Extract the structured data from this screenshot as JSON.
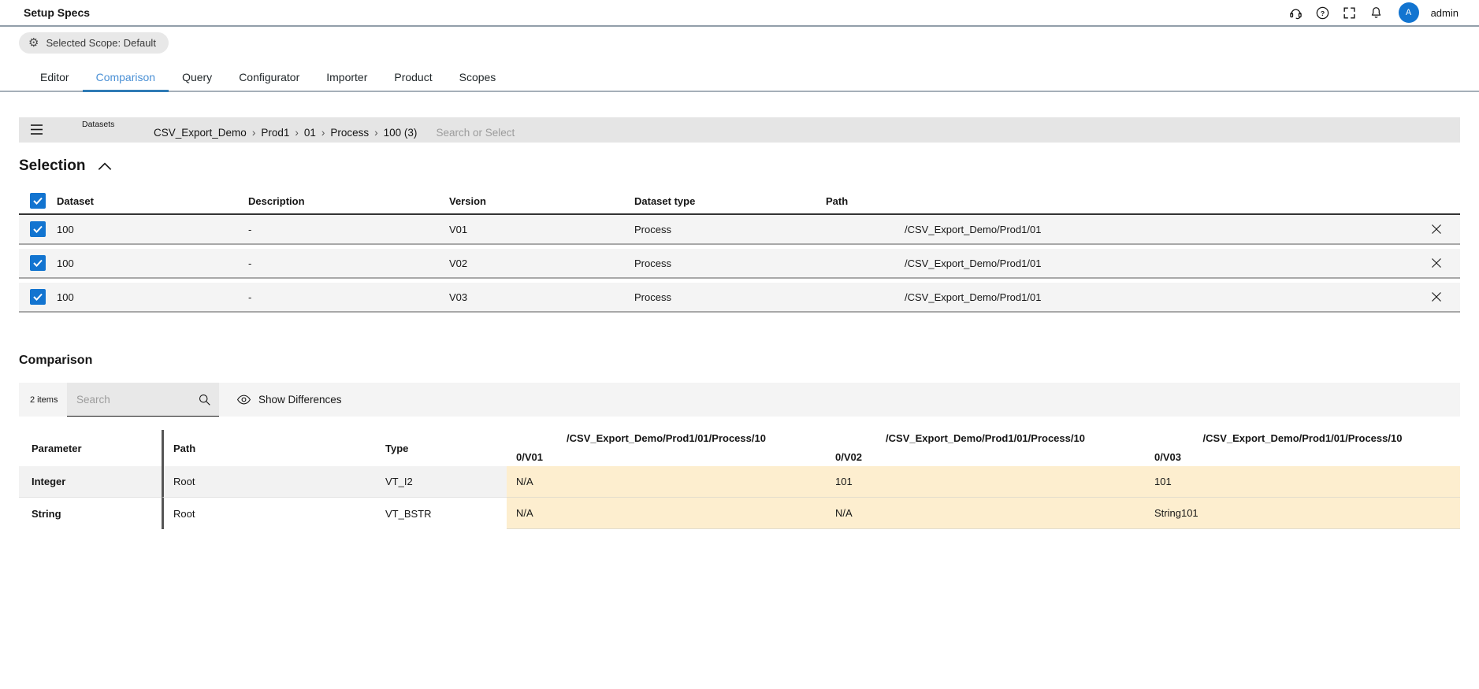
{
  "colors": {
    "accent_blue": "#1274d0",
    "active_tab_blue": "#4a90d5",
    "highlight_beige": "#fdeecf"
  },
  "icons": {
    "gear_glyph": "⚙"
  },
  "topbar": {
    "title": "Setup Specs",
    "help_glyph": "?",
    "avatar_initial": "A",
    "username": "admin"
  },
  "scope": {
    "label": "Selected Scope: Default"
  },
  "tabs": [
    {
      "label": "Editor",
      "active": false
    },
    {
      "label": "Comparison",
      "active": true
    },
    {
      "label": "Query",
      "active": false
    },
    {
      "label": "Configurator",
      "active": false
    },
    {
      "label": "Importer",
      "active": false
    },
    {
      "label": "Product",
      "active": false
    },
    {
      "label": "Scopes",
      "active": false
    }
  ],
  "datasets_bar": {
    "label": "Datasets",
    "separator": "›",
    "segments": [
      "CSV_Export_Demo",
      "Prod1",
      "01",
      "Process",
      "100 (3)"
    ],
    "search_placeholder": "Search or Select"
  },
  "selection": {
    "title": "Selection",
    "header_checked": true,
    "columns": {
      "dataset": "Dataset",
      "description": "Description",
      "version": "Version",
      "dataset_type": "Dataset type",
      "path": "Path"
    },
    "rows": [
      {
        "checked": true,
        "dataset": "100",
        "description": "-",
        "version": "V01",
        "dataset_type": "Process",
        "path": "/CSV_Export_Demo/Prod1/01"
      },
      {
        "checked": true,
        "dataset": "100",
        "description": "-",
        "version": "V02",
        "dataset_type": "Process",
        "path": "/CSV_Export_Demo/Prod1/01"
      },
      {
        "checked": true,
        "dataset": "100",
        "description": "-",
        "version": "V03",
        "dataset_type": "Process",
        "path": "/CSV_Export_Demo/Prod1/01"
      }
    ]
  },
  "comparison": {
    "title": "Comparison",
    "items_count": "2 items",
    "search_placeholder": "Search",
    "show_differences_label": "Show Differences",
    "group_path": "/CSV_Export_Demo/Prod1/01/Process/10",
    "columns": {
      "parameter": "Parameter",
      "path": "Path",
      "type": "Type"
    },
    "version_labels": [
      "0/V01",
      "0/V02",
      "0/V03"
    ],
    "rows": [
      {
        "parameter": "Integer",
        "path": "Root",
        "type": "VT_I2",
        "values": [
          "N/A",
          "101",
          "101"
        ]
      },
      {
        "parameter": "String",
        "path": "Root",
        "type": "VT_BSTR",
        "values": [
          "N/A",
          "N/A",
          "String101"
        ]
      }
    ]
  }
}
